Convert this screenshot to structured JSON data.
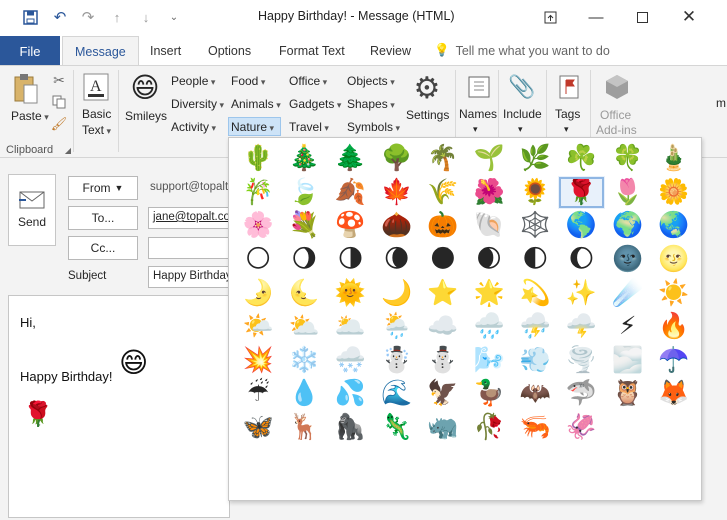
{
  "window": {
    "title": "Happy Birthday!  -  Message (HTML)",
    "titlebar_icons": [
      "save-icon",
      "undo-icon",
      "redo-icon",
      "up-arrow-icon",
      "down-arrow-icon",
      "customize-icon"
    ],
    "controls": [
      "restore-icon",
      "minimize-icon",
      "maximize-icon",
      "close-icon"
    ]
  },
  "tabs": {
    "file": "File",
    "items": [
      "Message",
      "Insert",
      "Options",
      "Format Text",
      "Review"
    ],
    "active": "Message",
    "tell_me": "Tell me what you want to do"
  },
  "ribbon": {
    "paste": "Paste",
    "clipboard": "Clipboard",
    "basic_text_1": "Basic",
    "basic_text_2": "Text",
    "smileys": "Smileys",
    "col1": [
      "People",
      "Diversity",
      "Activity"
    ],
    "col2": [
      "Food",
      "Animals",
      "Nature"
    ],
    "col3": [
      "Office",
      "Gadgets",
      "Travel"
    ],
    "col4": [
      "Objects",
      "Shapes",
      "Symbols"
    ],
    "settings": "Settings",
    "names": "Names",
    "include": "Include",
    "tags": "Tags",
    "office_addins_1": "Office",
    "office_addins_2": "Add-ins",
    "selected_category": "Nature"
  },
  "compose": {
    "send": "Send",
    "from_label": "From",
    "from_value": "support@topalt.com",
    "to_label": "To...",
    "to_value": "jane@topalt.com",
    "cc_label": "Cc...",
    "cc_value": "",
    "subject_label": "Subject",
    "subject_value": "Happy Birthday!",
    "body_line1": "Hi,",
    "body_line2": "Happy Birthday!",
    "body_emoji1": "😄",
    "body_emoji2": "🌹"
  },
  "emoji_grid": {
    "rows": [
      [
        "🌵",
        "🎄",
        "🌲",
        "🌳",
        "🌴",
        "🌱",
        "🌿",
        "☘️",
        "🍀",
        "🎍"
      ],
      [
        "🎋",
        "🍃",
        "🍂",
        "🍁",
        "🌾",
        "🌺",
        "🌻",
        "🌹",
        "🌷",
        "🌼"
      ],
      [
        "🌸",
        "💐",
        "🍄",
        "🌰",
        "🎃",
        "🐚",
        "🕸️",
        "🌎",
        "🌍",
        "🌏"
      ],
      [
        "🌕",
        "🌖",
        "🌗",
        "🌘",
        "🌑",
        "🌒",
        "🌓",
        "🌔",
        "🌚",
        "🌝"
      ],
      [
        "🌛",
        "🌜",
        "🌞",
        "🌙",
        "⭐",
        "🌟",
        "💫",
        "✨",
        "☄️",
        "☀️"
      ],
      [
        "🌤️",
        "⛅",
        "🌥️",
        "🌦️",
        "☁️",
        "🌧️",
        "⛈️",
        "🌩️",
        "⚡",
        "🔥"
      ],
      [
        "💥",
        "❄️",
        "🌨️",
        "☃️",
        "⛄",
        "🌬️",
        "💨",
        "🌪️",
        "🌫️",
        "☂️"
      ],
      [
        "☔",
        "💧",
        "💦",
        "🌊",
        "🦅",
        "🦆",
        "🦇",
        "🦈",
        "🦉",
        "🦊"
      ],
      [
        "🦋",
        "🦌",
        "🦍",
        "🦎",
        "🦏",
        "🥀",
        "🦐",
        "🦑"
      ]
    ],
    "selected": "🌹"
  },
  "colors": {
    "brand": "#2b579a",
    "ribbon_bg": "#f3f3f3",
    "selection": "#cde3f7"
  }
}
